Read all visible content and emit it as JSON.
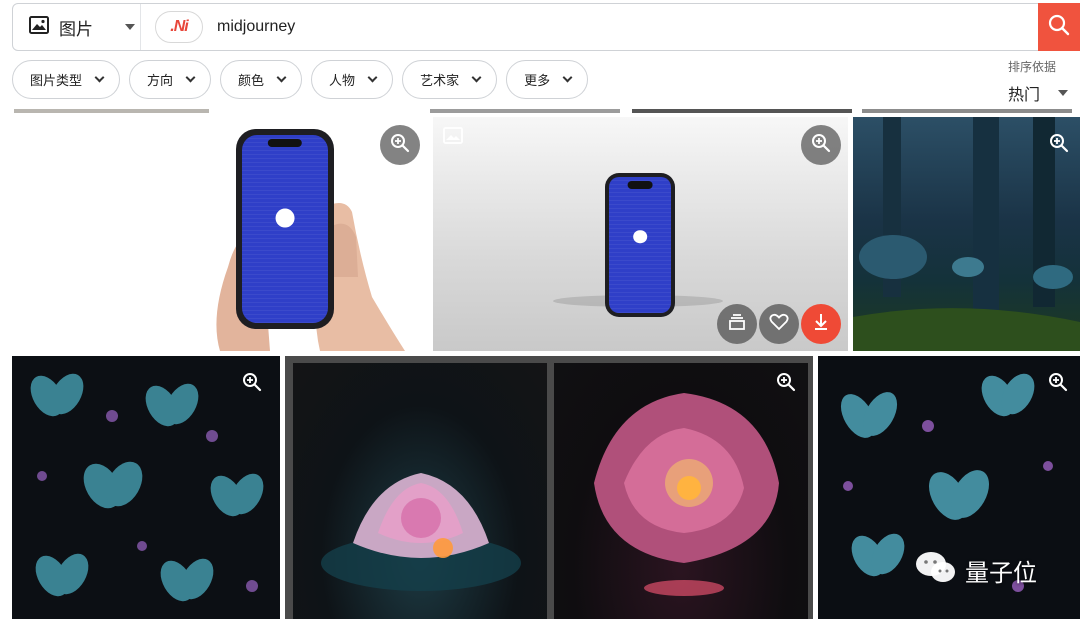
{
  "search": {
    "type_label": "图片",
    "ai_badge": ".Ni",
    "query": "midjourney"
  },
  "filters": [
    {
      "label": "图片类型"
    },
    {
      "label": "方向"
    },
    {
      "label": "颜色"
    },
    {
      "label": "人物"
    },
    {
      "label": "艺术家"
    },
    {
      "label": "更多"
    }
  ],
  "sort": {
    "label": "排序依据",
    "value": "热门"
  },
  "watermark": {
    "text": "量子位"
  },
  "colors": {
    "accent": "#f0533e",
    "download": "#ef4a36"
  },
  "icons": {
    "type": "image-icon",
    "search": "search-icon",
    "zoom": "zoom-in-icon",
    "collection": "stack-icon",
    "like": "heart-icon",
    "download": "download-icon",
    "wechat": "wechat-icon"
  }
}
